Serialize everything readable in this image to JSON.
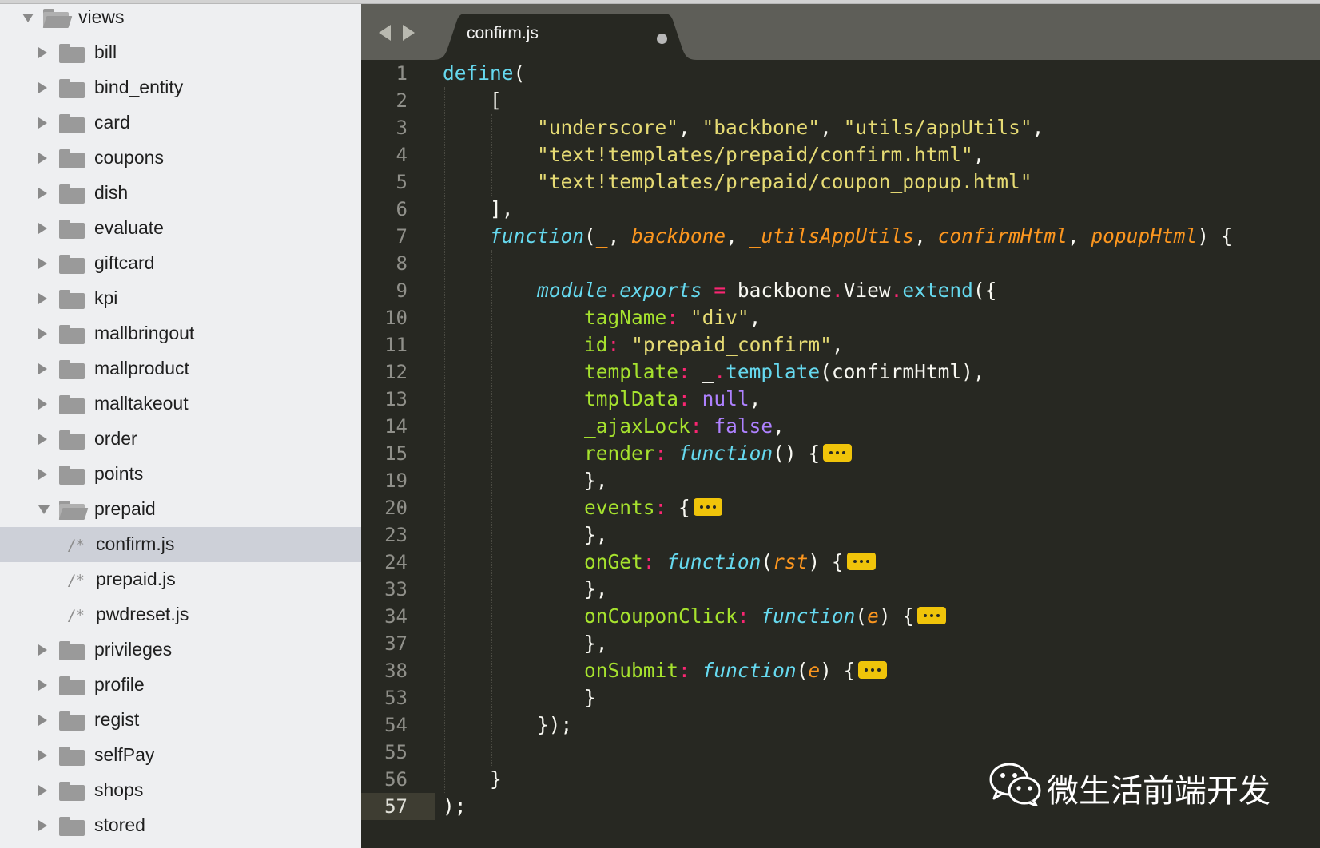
{
  "sidebar": {
    "items": [
      {
        "label": "views",
        "kind": "folder",
        "state": "expanded",
        "depth": 0
      },
      {
        "label": "bill",
        "kind": "folder",
        "state": "collapsed",
        "depth": 1
      },
      {
        "label": "bind_entity",
        "kind": "folder",
        "state": "collapsed",
        "depth": 1
      },
      {
        "label": "card",
        "kind": "folder",
        "state": "collapsed",
        "depth": 1
      },
      {
        "label": "coupons",
        "kind": "folder",
        "state": "collapsed",
        "depth": 1
      },
      {
        "label": "dish",
        "kind": "folder",
        "state": "collapsed",
        "depth": 1
      },
      {
        "label": "evaluate",
        "kind": "folder",
        "state": "collapsed",
        "depth": 1
      },
      {
        "label": "giftcard",
        "kind": "folder",
        "state": "collapsed",
        "depth": 1
      },
      {
        "label": "kpi",
        "kind": "folder",
        "state": "collapsed",
        "depth": 1
      },
      {
        "label": "mallbringout",
        "kind": "folder",
        "state": "collapsed",
        "depth": 1
      },
      {
        "label": "mallproduct",
        "kind": "folder",
        "state": "collapsed",
        "depth": 1
      },
      {
        "label": "malltakeout",
        "kind": "folder",
        "state": "collapsed",
        "depth": 1
      },
      {
        "label": "order",
        "kind": "folder",
        "state": "collapsed",
        "depth": 1
      },
      {
        "label": "points",
        "kind": "folder",
        "state": "collapsed",
        "depth": 1
      },
      {
        "label": "prepaid",
        "kind": "folder",
        "state": "expanded",
        "depth": 1
      },
      {
        "label": "confirm.js",
        "kind": "file",
        "icon": "/*",
        "depth": 2,
        "selected": true
      },
      {
        "label": "prepaid.js",
        "kind": "file",
        "icon": "/*",
        "depth": 2
      },
      {
        "label": "pwdreset.js",
        "kind": "file",
        "icon": "/*",
        "depth": 2
      },
      {
        "label": "privileges",
        "kind": "folder",
        "state": "collapsed",
        "depth": 1
      },
      {
        "label": "profile",
        "kind": "folder",
        "state": "collapsed",
        "depth": 1
      },
      {
        "label": "regist",
        "kind": "folder",
        "state": "collapsed",
        "depth": 1
      },
      {
        "label": "selfPay",
        "kind": "folder",
        "state": "collapsed",
        "depth": 1
      },
      {
        "label": "shops",
        "kind": "folder",
        "state": "collapsed",
        "depth": 1
      },
      {
        "label": "stored",
        "kind": "folder",
        "state": "collapsed",
        "depth": 1
      }
    ]
  },
  "tab": {
    "title": "confirm.js",
    "dirty_indicator": "unsaved-dot-icon"
  },
  "editor": {
    "current_line": "57",
    "lines": [
      {
        "no": "1",
        "tokens": [
          [
            "def",
            "define"
          ],
          [
            "plain",
            "("
          ]
        ]
      },
      {
        "no": "2",
        "tokens": [
          [
            "plain",
            "    ["
          ]
        ]
      },
      {
        "no": "3",
        "tokens": [
          [
            "plain",
            "        "
          ],
          [
            "str",
            "\"underscore\""
          ],
          [
            "plain",
            ", "
          ],
          [
            "str",
            "\"backbone\""
          ],
          [
            "plain",
            ", "
          ],
          [
            "str",
            "\"utils/appUtils\""
          ],
          [
            "plain",
            ","
          ]
        ]
      },
      {
        "no": "4",
        "tokens": [
          [
            "plain",
            "        "
          ],
          [
            "str",
            "\"text!templates/prepaid/confirm.html\""
          ],
          [
            "plain",
            ","
          ]
        ]
      },
      {
        "no": "5",
        "tokens": [
          [
            "plain",
            "        "
          ],
          [
            "str",
            "\"text!templates/prepaid/coupon_popup.html\""
          ]
        ]
      },
      {
        "no": "6",
        "tokens": [
          [
            "plain",
            "    ],"
          ]
        ]
      },
      {
        "no": "7",
        "tokens": [
          [
            "plain",
            "    "
          ],
          [
            "fn",
            "function"
          ],
          [
            "plain",
            "("
          ],
          [
            "param",
            "_"
          ],
          [
            "plain",
            ", "
          ],
          [
            "param",
            "backbone"
          ],
          [
            "plain",
            ", "
          ],
          [
            "param",
            "_utilsAppUtils"
          ],
          [
            "plain",
            ", "
          ],
          [
            "param",
            "confirmHtml"
          ],
          [
            "plain",
            ", "
          ],
          [
            "param",
            "popupHtml"
          ],
          [
            "plain",
            ") {"
          ]
        ]
      },
      {
        "no": "8",
        "tokens": []
      },
      {
        "no": "9",
        "tokens": [
          [
            "plain",
            "        "
          ],
          [
            "mod",
            "module"
          ],
          [
            "op",
            "."
          ],
          [
            "mod",
            "exports"
          ],
          [
            "plain",
            " "
          ],
          [
            "op",
            "="
          ],
          [
            "plain",
            " backbone"
          ],
          [
            "op",
            "."
          ],
          [
            "plain",
            "View"
          ],
          [
            "op",
            "."
          ],
          [
            "call",
            "extend"
          ],
          [
            "plain",
            "({"
          ]
        ]
      },
      {
        "no": "10",
        "tokens": [
          [
            "plain",
            "            "
          ],
          [
            "key",
            "tagName"
          ],
          [
            "op",
            ":"
          ],
          [
            "plain",
            " "
          ],
          [
            "str",
            "\"div\""
          ],
          [
            "plain",
            ","
          ]
        ]
      },
      {
        "no": "11",
        "tokens": [
          [
            "plain",
            "            "
          ],
          [
            "key",
            "id"
          ],
          [
            "op",
            ":"
          ],
          [
            "plain",
            " "
          ],
          [
            "str",
            "\"prepaid_confirm\""
          ],
          [
            "plain",
            ","
          ]
        ]
      },
      {
        "no": "12",
        "tokens": [
          [
            "plain",
            "            "
          ],
          [
            "key",
            "template"
          ],
          [
            "op",
            ":"
          ],
          [
            "plain",
            " _"
          ],
          [
            "op",
            "."
          ],
          [
            "call",
            "template"
          ],
          [
            "plain",
            "(confirmHtml),"
          ]
        ]
      },
      {
        "no": "13",
        "tokens": [
          [
            "plain",
            "            "
          ],
          [
            "key",
            "tmplData"
          ],
          [
            "op",
            ":"
          ],
          [
            "plain",
            " "
          ],
          [
            "const",
            "null"
          ],
          [
            "plain",
            ","
          ]
        ]
      },
      {
        "no": "14",
        "tokens": [
          [
            "plain",
            "            "
          ],
          [
            "key",
            "_ajaxLock"
          ],
          [
            "op",
            ":"
          ],
          [
            "plain",
            " "
          ],
          [
            "const",
            "false"
          ],
          [
            "plain",
            ","
          ]
        ]
      },
      {
        "no": "15",
        "tokens": [
          [
            "plain",
            "            "
          ],
          [
            "key",
            "render"
          ],
          [
            "op",
            ":"
          ],
          [
            "plain",
            " "
          ],
          [
            "fn",
            "function"
          ],
          [
            "plain",
            "() {"
          ],
          [
            "fold",
            ""
          ]
        ]
      },
      {
        "no": "19",
        "tokens": [
          [
            "plain",
            "            },"
          ]
        ]
      },
      {
        "no": "20",
        "tokens": [
          [
            "plain",
            "            "
          ],
          [
            "key",
            "events"
          ],
          [
            "op",
            ":"
          ],
          [
            "plain",
            " {"
          ],
          [
            "fold",
            ""
          ]
        ]
      },
      {
        "no": "23",
        "tokens": [
          [
            "plain",
            "            },"
          ]
        ]
      },
      {
        "no": "24",
        "tokens": [
          [
            "plain",
            "            "
          ],
          [
            "key",
            "onGet"
          ],
          [
            "op",
            ":"
          ],
          [
            "plain",
            " "
          ],
          [
            "fn",
            "function"
          ],
          [
            "plain",
            "("
          ],
          [
            "param",
            "rst"
          ],
          [
            "plain",
            ") {"
          ],
          [
            "fold",
            ""
          ]
        ]
      },
      {
        "no": "33",
        "tokens": [
          [
            "plain",
            "            },"
          ]
        ]
      },
      {
        "no": "34",
        "tokens": [
          [
            "plain",
            "            "
          ],
          [
            "key",
            "onCouponClick"
          ],
          [
            "op",
            ":"
          ],
          [
            "plain",
            " "
          ],
          [
            "fn",
            "function"
          ],
          [
            "plain",
            "("
          ],
          [
            "param",
            "e"
          ],
          [
            "plain",
            ") {"
          ],
          [
            "fold",
            ""
          ]
        ]
      },
      {
        "no": "37",
        "tokens": [
          [
            "plain",
            "            },"
          ]
        ]
      },
      {
        "no": "38",
        "tokens": [
          [
            "plain",
            "            "
          ],
          [
            "key",
            "onSubmit"
          ],
          [
            "op",
            ":"
          ],
          [
            "plain",
            " "
          ],
          [
            "fn",
            "function"
          ],
          [
            "plain",
            "("
          ],
          [
            "param",
            "e"
          ],
          [
            "plain",
            ") {"
          ],
          [
            "fold",
            ""
          ]
        ]
      },
      {
        "no": "53",
        "tokens": [
          [
            "plain",
            "            }"
          ]
        ]
      },
      {
        "no": "54",
        "tokens": [
          [
            "plain",
            "        });"
          ]
        ]
      },
      {
        "no": "55",
        "tokens": []
      },
      {
        "no": "56",
        "tokens": [
          [
            "plain",
            "    }"
          ]
        ]
      },
      {
        "no": "57",
        "tokens": [
          [
            "plain",
            ");"
          ]
        ]
      }
    ]
  },
  "theme": {
    "editor_bg": "#272822",
    "sidebar_bg": "#eeeff1",
    "selection_bg": "#cdd0d8",
    "fold_marker": "#f0c40a"
  },
  "watermark": {
    "icon": "wechat-icon",
    "text": "微生活前端开发"
  }
}
